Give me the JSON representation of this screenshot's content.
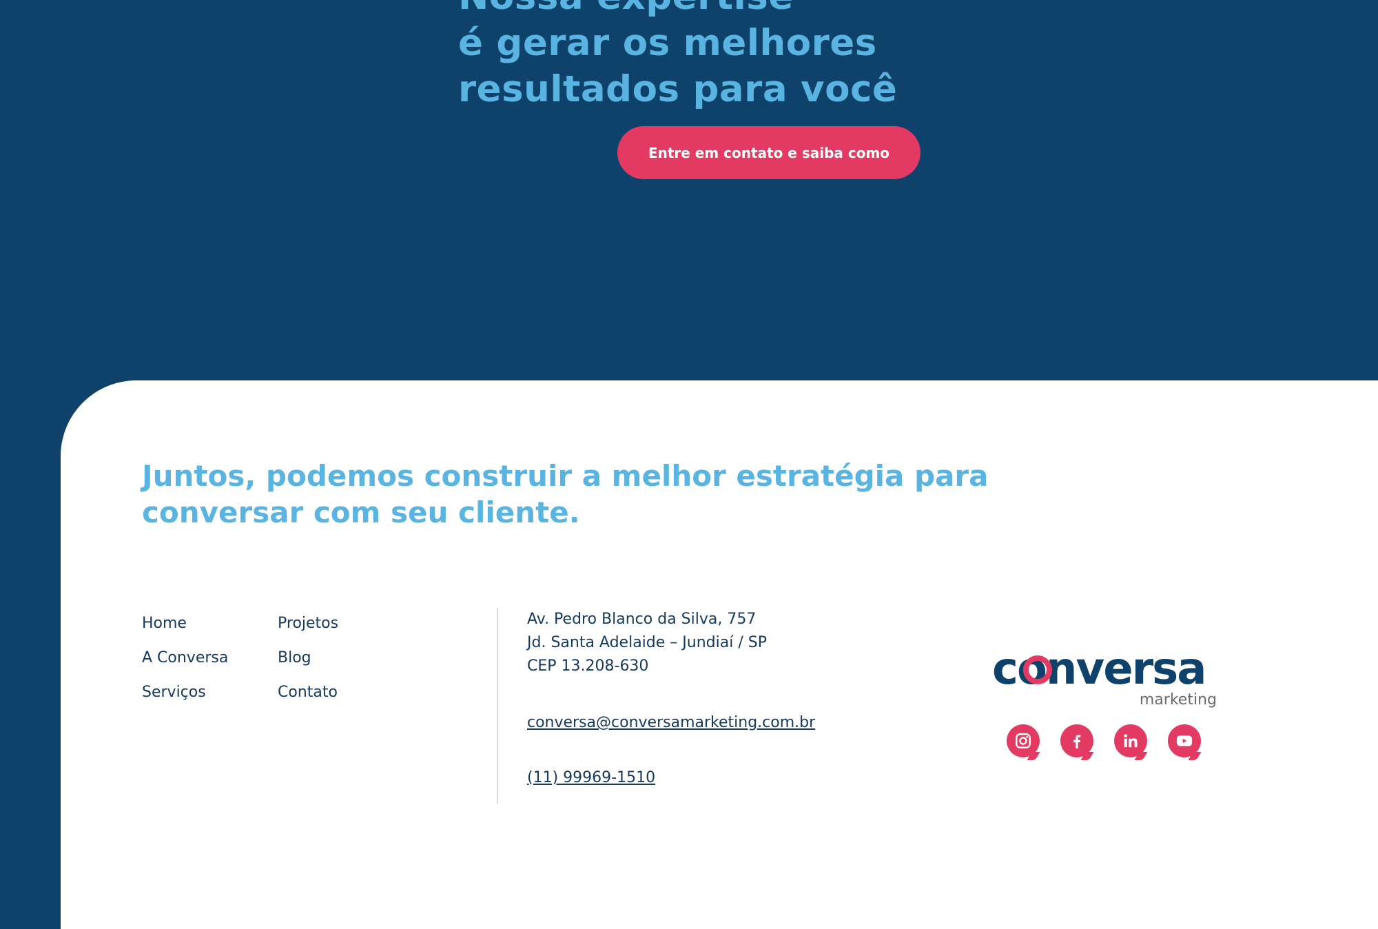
{
  "hero": {
    "title_lines": [
      "Nossa expertise",
      "é gerar os melhores",
      "resultados para você"
    ],
    "cta_label": "Entre em contato e saiba como"
  },
  "footer": {
    "tagline": "Juntos, podemos construir a melhor estratégia para conversar com seu cliente.",
    "nav": {
      "col1": [
        "Home",
        "A Conversa",
        "Serviços"
      ],
      "col2": [
        "Projetos",
        "Blog",
        "Contato"
      ]
    },
    "address": [
      "Av. Pedro Blanco da Silva, 757",
      "Jd. Santa Adelaide – Jundiaí / SP",
      "CEP 13.208-630"
    ],
    "email": "conversa@conversamarketing.com.br",
    "phone": "(11) 99969-1510",
    "logo": {
      "brand": "conversa",
      "sub": "marketing"
    },
    "socials": [
      "instagram-icon",
      "facebook-icon",
      "linkedin-icon",
      "youtube-icon"
    ]
  },
  "colors": {
    "background": "#0f426b",
    "accent_pink": "#e23a63",
    "light_blue": "#5ab4e1",
    "text_dark": "#16395c"
  }
}
